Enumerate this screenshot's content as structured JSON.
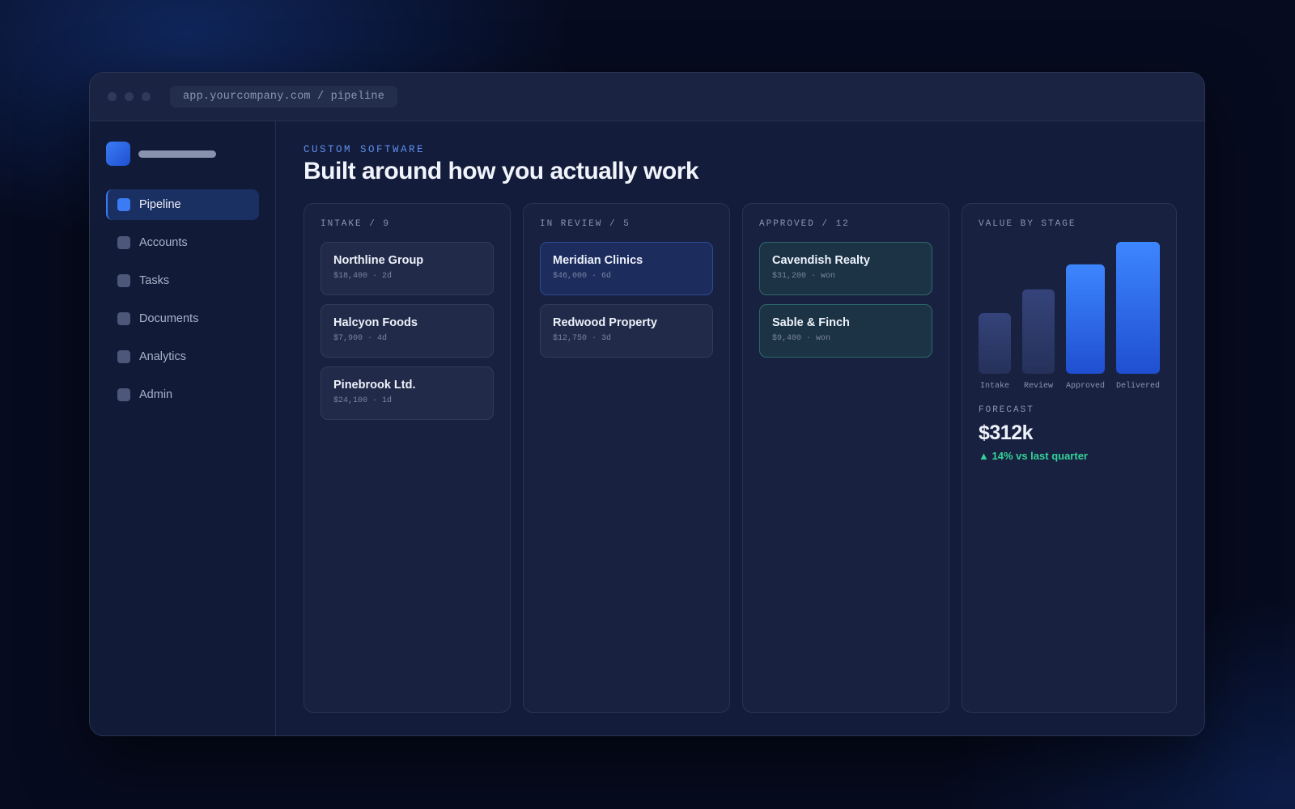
{
  "window": {
    "url": "app.yourcompany.com / pipeline"
  },
  "sidebar": {
    "items": [
      {
        "label": "Pipeline",
        "icon": "square-icon",
        "active": true
      },
      {
        "label": "Accounts",
        "icon": "square-icon",
        "active": false
      },
      {
        "label": "Tasks",
        "icon": "square-icon",
        "active": false
      },
      {
        "label": "Documents",
        "icon": "square-icon",
        "active": false
      },
      {
        "label": "Analytics",
        "icon": "square-icon",
        "active": false
      },
      {
        "label": "Admin",
        "icon": "square-icon",
        "active": false
      }
    ]
  },
  "header": {
    "eyebrow": "CUSTOM SOFTWARE",
    "title": "Built around how you actually work"
  },
  "columns": [
    {
      "title": "INTAKE / 9",
      "variant": "default",
      "cards": [
        {
          "name": "Northline Group",
          "meta": "$18,400 · 2d"
        },
        {
          "name": "Halcyon Foods",
          "meta": "$7,900 · 4d"
        },
        {
          "name": "Pinebrook Ltd.",
          "meta": "$24,100 · 1d"
        }
      ]
    },
    {
      "title": "IN REVIEW / 5",
      "variant": "review",
      "cards": [
        {
          "name": "Meridian Clinics",
          "meta": "$46,000 · 6d",
          "variant": "review"
        },
        {
          "name": "Redwood Property",
          "meta": "$12,750 · 3d",
          "variant": "default"
        }
      ]
    },
    {
      "title": "APPROVED / 12",
      "variant": "won",
      "cards": [
        {
          "name": "Cavendish Realty",
          "meta": "$31,200 · won",
          "variant": "won"
        },
        {
          "name": "Sable & Finch",
          "meta": "$9,400 · won",
          "variant": "won"
        }
      ]
    }
  ],
  "stats": {
    "title": "VALUE BY STAGE",
    "forecast_label": "FORECAST",
    "forecast_value": "$312k",
    "forecast_delta": "▲ 14% vs last quarter"
  },
  "chart_data": {
    "type": "bar",
    "categories": [
      "Intake",
      "Review",
      "Approved",
      "Delivered"
    ],
    "values": [
      46,
      64,
      83,
      100
    ],
    "ylim": [
      0,
      100
    ],
    "colors": [
      "#2c3a66",
      "#2c3a66",
      "#2f6cf0",
      "#2f6cf0"
    ],
    "grid": false
  },
  "colors": {
    "accent": "#3b7cf4",
    "positive": "#34d399",
    "background": "#060b1f"
  }
}
